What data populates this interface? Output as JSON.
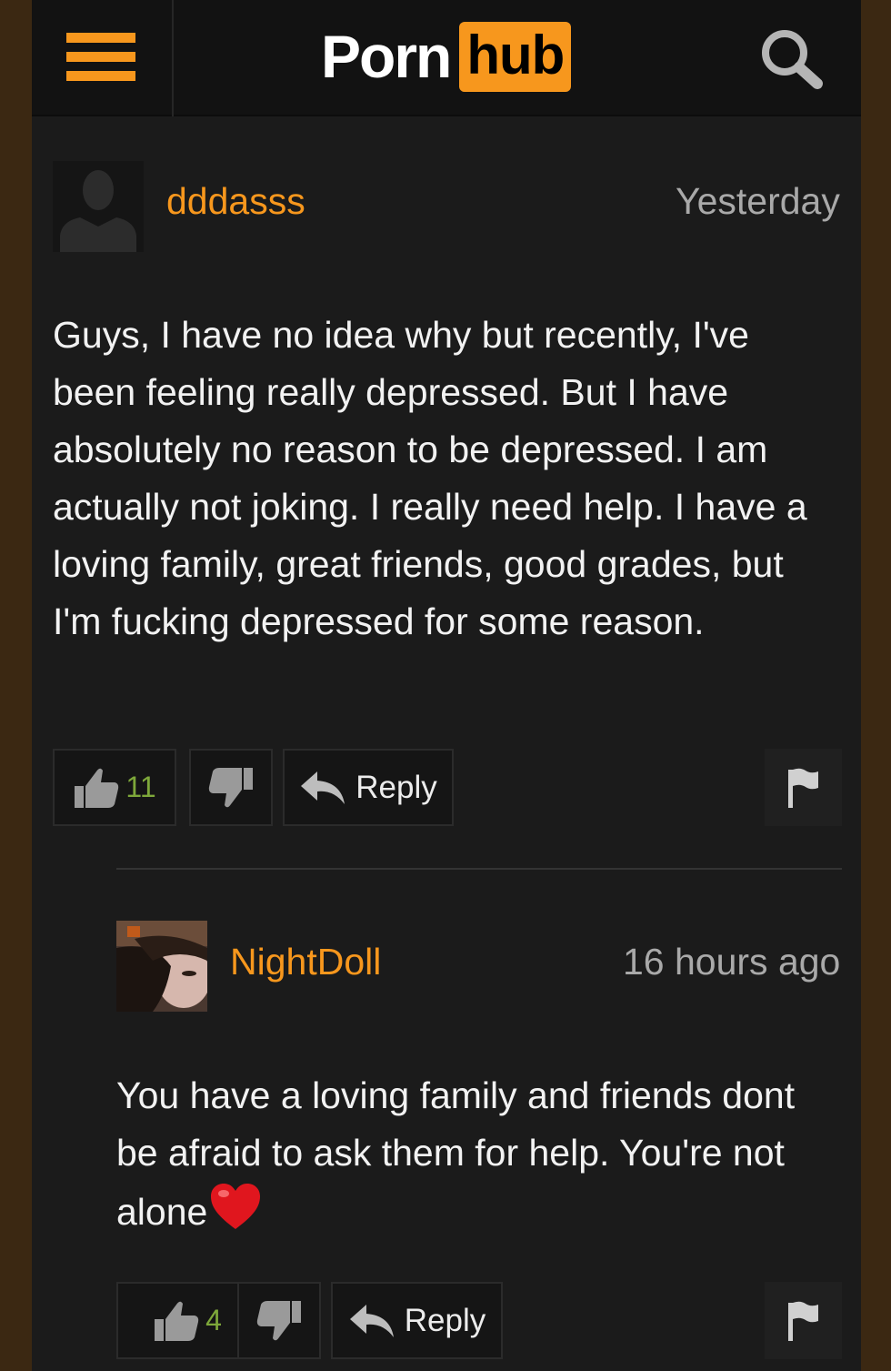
{
  "header": {
    "menu_icon": "hamburger-menu-icon",
    "logo_part1": "Porn",
    "logo_part2": "hub",
    "search_icon": "search-icon",
    "accent_color": "#f7971d"
  },
  "comments": [
    {
      "username": "dddasss",
      "timestamp": "Yesterday",
      "avatar": "default-avatar-icon",
      "text": "Guys, I have no idea why but recently, I've been feeling really depressed. But I have absolutely no reason to be depressed. I am actually not joking. I really need help. I have a loving family, great friends, good grades, but I'm fucking depressed for some reason.",
      "likes": "11",
      "reply_label": "Reply"
    },
    {
      "username": "NightDoll",
      "timestamp": "16 hours ago",
      "avatar": "user-photo-avatar",
      "text": "You have a loving family and friends dont be afraid to ask them for help. You're not alone",
      "emoji": "red-heart-emoji",
      "likes": "4",
      "reply_label": "Reply"
    }
  ]
}
